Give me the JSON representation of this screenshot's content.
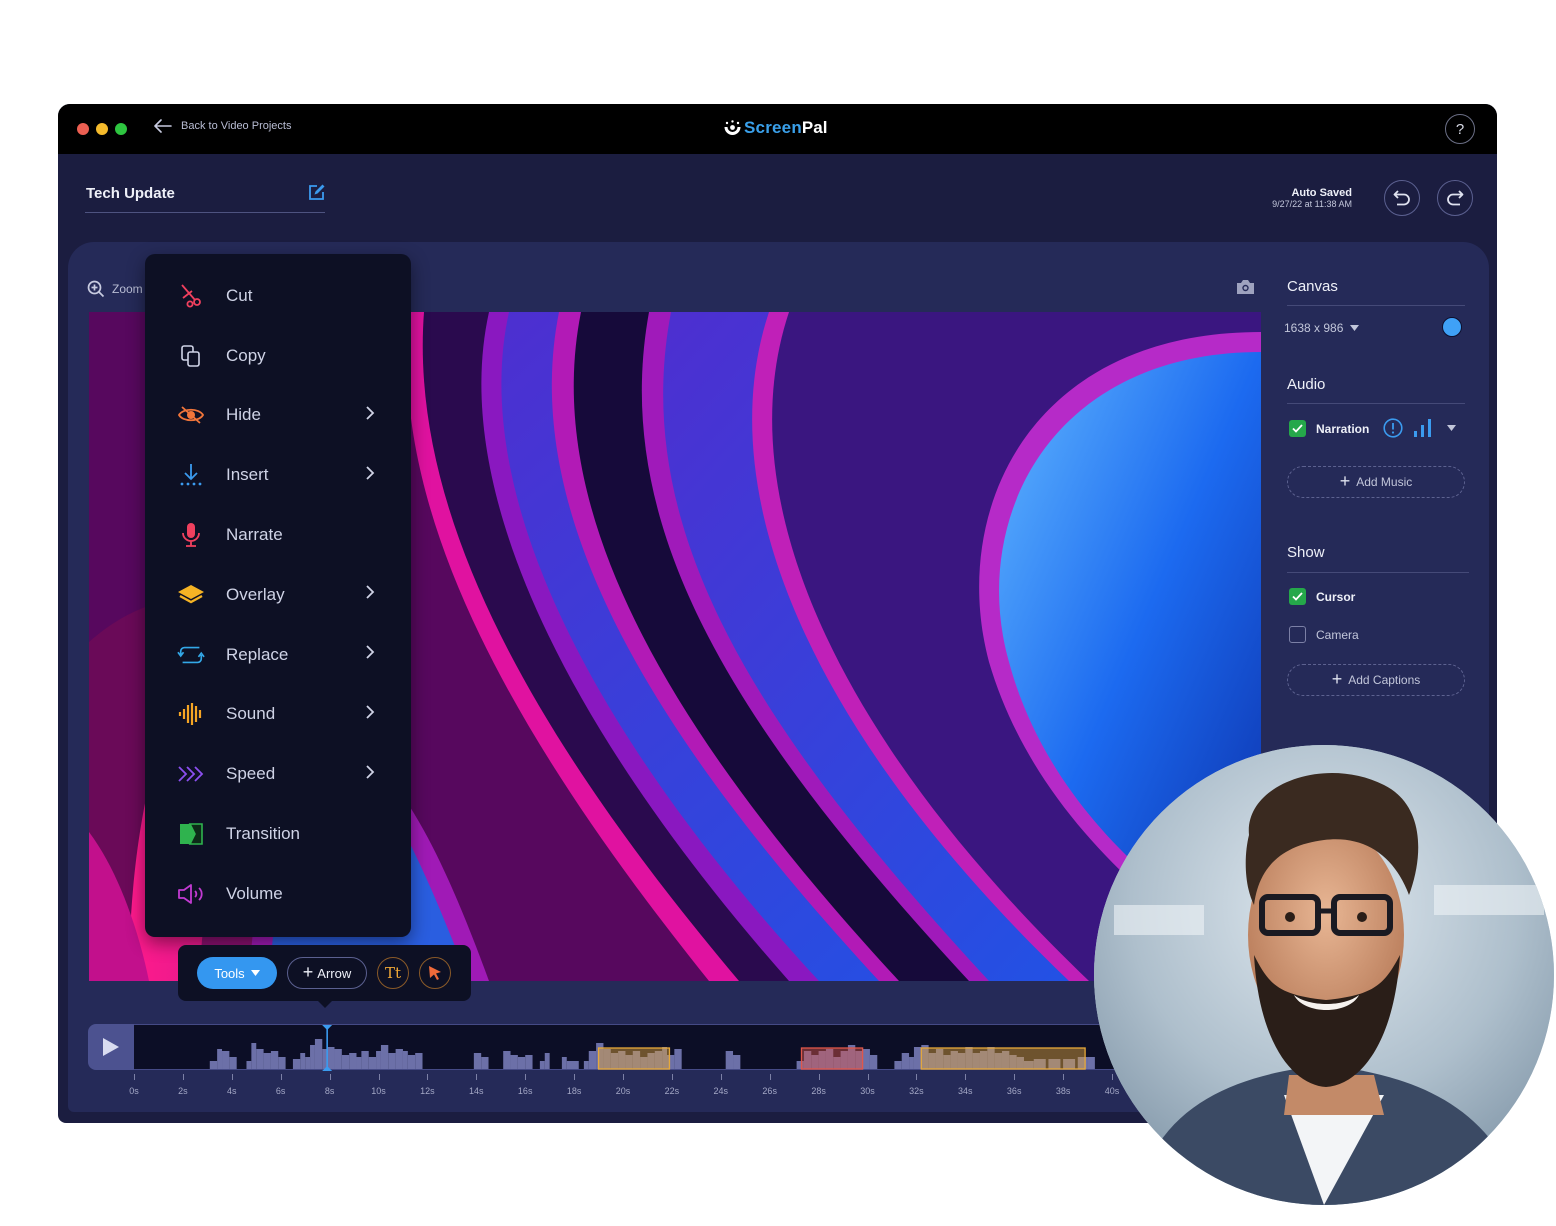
{
  "window": {
    "back_label": "Back to Video Projects",
    "brand": {
      "part1": "Screen",
      "part2": "Pal"
    },
    "help_label": "?"
  },
  "project": {
    "title": "Tech Update",
    "autosave_label": "Auto Saved",
    "autosave_time": "9/27/22 at 11:38 AM"
  },
  "editor": {
    "zoom_label": "Zoom"
  },
  "context_menu": {
    "items": [
      {
        "label": "Cut",
        "icon": "scissors-icon",
        "color": "#f0405e",
        "submenu": false
      },
      {
        "label": "Copy",
        "icon": "copy-icon",
        "color": "#cfd3e6",
        "submenu": false
      },
      {
        "label": "Hide",
        "icon": "eye-off-icon",
        "color": "#f0753a",
        "submenu": true
      },
      {
        "label": "Insert",
        "icon": "insert-icon",
        "color": "#3b9bef",
        "submenu": true
      },
      {
        "label": "Narrate",
        "icon": "microphone-icon",
        "color": "#f0405e",
        "submenu": false
      },
      {
        "label": "Overlay",
        "icon": "layers-icon",
        "color": "#f5b324",
        "submenu": true
      },
      {
        "label": "Replace",
        "icon": "replace-icon",
        "color": "#33a8e8",
        "submenu": true
      },
      {
        "label": "Sound",
        "icon": "waveform-icon",
        "color": "#f5a524",
        "submenu": true
      },
      {
        "label": "Speed",
        "icon": "speed-chevrons-icon",
        "color": "#8b4ff0",
        "submenu": true
      },
      {
        "label": "Transition",
        "icon": "transition-icon",
        "color": "#2fb34e",
        "submenu": false
      },
      {
        "label": "Volume",
        "icon": "speaker-icon",
        "color": "#c23ad2",
        "submenu": false
      }
    ]
  },
  "toolbar": {
    "tools_label": "Tools",
    "arrow_label": "Arrow",
    "text_tool_label": "Tt"
  },
  "right_panel": {
    "canvas": {
      "title": "Canvas",
      "size": "1638 x 986",
      "color": "#3fa1f7"
    },
    "audio": {
      "title": "Audio",
      "narration_label": "Narration",
      "narration_checked": true,
      "add_music_label": "Add Music"
    },
    "show": {
      "title": "Show",
      "cursor_label": "Cursor",
      "cursor_checked": true,
      "camera_label": "Camera",
      "camera_checked": false,
      "add_captions_label": "Add Captions"
    }
  },
  "timeline": {
    "playhead_seconds": 7.9,
    "tick_labels": [
      "0s",
      "2s",
      "4s",
      "6s",
      "8s",
      "10s",
      "12s",
      "14s",
      "16s",
      "18s",
      "20s",
      "22s",
      "24s",
      "26s",
      "28s",
      "30s",
      "32s",
      "34s",
      "36s",
      "38s",
      "40s"
    ],
    "segments": [
      {
        "type": "overlay",
        "start": 19.0,
        "end": 21.9,
        "color": "#e7a93a"
      },
      {
        "type": "cut",
        "start": 27.3,
        "end": 29.8,
        "color": "#e0574a"
      },
      {
        "type": "overlay",
        "start": 32.2,
        "end": 38.9,
        "color": "#e7a93a"
      }
    ]
  }
}
